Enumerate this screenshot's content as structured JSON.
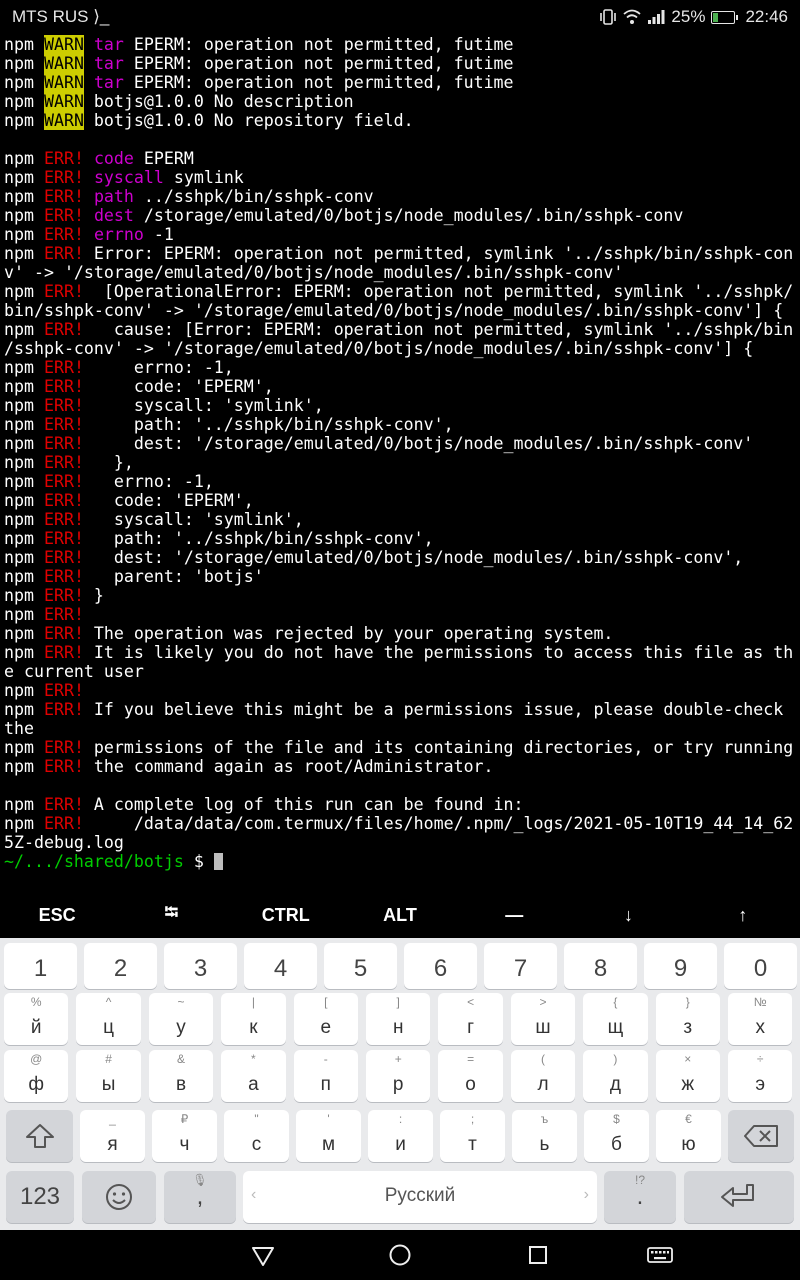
{
  "status_bar": {
    "carrier": "MTS RUS",
    "carrier_suffix": "⟩_",
    "battery": "25%",
    "battery_level": 0.25,
    "time": "22:46"
  },
  "terminal": {
    "lines": [
      [
        [
          "npm ",
          ""
        ],
        [
          "WARN",
          "warn"
        ],
        [
          " ",
          ""
        ],
        [
          "tar",
          "mag"
        ],
        [
          " EPERM: operation not permitted, futime",
          ""
        ]
      ],
      [
        [
          "npm ",
          ""
        ],
        [
          "WARN",
          "warn"
        ],
        [
          " ",
          ""
        ],
        [
          "tar",
          "mag"
        ],
        [
          " EPERM: operation not permitted, futime",
          ""
        ]
      ],
      [
        [
          "npm ",
          ""
        ],
        [
          "WARN",
          "warn"
        ],
        [
          " ",
          ""
        ],
        [
          "tar",
          "mag"
        ],
        [
          " EPERM: operation not permitted, futime",
          ""
        ]
      ],
      [
        [
          "npm ",
          ""
        ],
        [
          "WARN",
          "warn"
        ],
        [
          " botjs@1.0.0 No description",
          ""
        ]
      ],
      [
        [
          "npm ",
          ""
        ],
        [
          "WARN",
          "warn"
        ],
        [
          " botjs@1.0.0 No repository field.",
          ""
        ]
      ],
      [],
      [
        [
          "npm ",
          ""
        ],
        [
          "ERR!",
          "err"
        ],
        [
          " ",
          ""
        ],
        [
          "code",
          "mag"
        ],
        [
          " EPERM",
          ""
        ]
      ],
      [
        [
          "npm ",
          ""
        ],
        [
          "ERR!",
          "err"
        ],
        [
          " ",
          ""
        ],
        [
          "syscall",
          "mag"
        ],
        [
          " symlink",
          ""
        ]
      ],
      [
        [
          "npm ",
          ""
        ],
        [
          "ERR!",
          "err"
        ],
        [
          " ",
          ""
        ],
        [
          "path",
          "mag"
        ],
        [
          " ../sshpk/bin/sshpk-conv",
          ""
        ]
      ],
      [
        [
          "npm ",
          ""
        ],
        [
          "ERR!",
          "err"
        ],
        [
          " ",
          ""
        ],
        [
          "dest",
          "mag"
        ],
        [
          " /storage/emulated/0/botjs/node_modules/.bin/sshpk-conv",
          ""
        ]
      ],
      [
        [
          "npm ",
          ""
        ],
        [
          "ERR!",
          "err"
        ],
        [
          " ",
          ""
        ],
        [
          "errno",
          "mag"
        ],
        [
          " -1",
          ""
        ]
      ],
      [
        [
          "npm ",
          ""
        ],
        [
          "ERR!",
          "err"
        ],
        [
          " Error: EPERM: operation not permitted, symlink '../sshpk/bin/sshpk-con",
          ""
        ]
      ],
      [
        [
          "v' -> '/storage/emulated/0/botjs/node_modules/.bin/sshpk-conv'",
          ""
        ]
      ],
      [
        [
          "npm ",
          ""
        ],
        [
          "ERR!",
          "err"
        ],
        [
          "  [OperationalError: EPERM: operation not permitted, symlink '../sshpk/",
          ""
        ]
      ],
      [
        [
          "bin/sshpk-conv' -> '/storage/emulated/0/botjs/node_modules/.bin/sshpk-conv'] {",
          ""
        ]
      ],
      [
        [
          "npm ",
          ""
        ],
        [
          "ERR!",
          "err"
        ],
        [
          "   cause: [Error: EPERM: operation not permitted, symlink '../sshpk/bin",
          ""
        ]
      ],
      [
        [
          "/sshpk-conv' -> '/storage/emulated/0/botjs/node_modules/.bin/sshpk-conv'] {",
          ""
        ]
      ],
      [
        [
          "npm ",
          ""
        ],
        [
          "ERR!",
          "err"
        ],
        [
          "     errno: -1,",
          ""
        ]
      ],
      [
        [
          "npm ",
          ""
        ],
        [
          "ERR!",
          "err"
        ],
        [
          "     code: 'EPERM',",
          ""
        ]
      ],
      [
        [
          "npm ",
          ""
        ],
        [
          "ERR!",
          "err"
        ],
        [
          "     syscall: 'symlink',",
          ""
        ]
      ],
      [
        [
          "npm ",
          ""
        ],
        [
          "ERR!",
          "err"
        ],
        [
          "     path: '../sshpk/bin/sshpk-conv',",
          ""
        ]
      ],
      [
        [
          "npm ",
          ""
        ],
        [
          "ERR!",
          "err"
        ],
        [
          "     dest: '/storage/emulated/0/botjs/node_modules/.bin/sshpk-conv'",
          ""
        ]
      ],
      [
        [
          "npm ",
          ""
        ],
        [
          "ERR!",
          "err"
        ],
        [
          "   },",
          ""
        ]
      ],
      [
        [
          "npm ",
          ""
        ],
        [
          "ERR!",
          "err"
        ],
        [
          "   errno: -1,",
          ""
        ]
      ],
      [
        [
          "npm ",
          ""
        ],
        [
          "ERR!",
          "err"
        ],
        [
          "   code: 'EPERM',",
          ""
        ]
      ],
      [
        [
          "npm ",
          ""
        ],
        [
          "ERR!",
          "err"
        ],
        [
          "   syscall: 'symlink',",
          ""
        ]
      ],
      [
        [
          "npm ",
          ""
        ],
        [
          "ERR!",
          "err"
        ],
        [
          "   path: '../sshpk/bin/sshpk-conv',",
          ""
        ]
      ],
      [
        [
          "npm ",
          ""
        ],
        [
          "ERR!",
          "err"
        ],
        [
          "   dest: '/storage/emulated/0/botjs/node_modules/.bin/sshpk-conv',",
          ""
        ]
      ],
      [
        [
          "npm ",
          ""
        ],
        [
          "ERR!",
          "err"
        ],
        [
          "   parent: 'botjs'",
          ""
        ]
      ],
      [
        [
          "npm ",
          ""
        ],
        [
          "ERR!",
          "err"
        ],
        [
          " }",
          ""
        ]
      ],
      [
        [
          "npm ",
          ""
        ],
        [
          "ERR!",
          "err"
        ]
      ],
      [
        [
          "npm ",
          ""
        ],
        [
          "ERR!",
          "err"
        ],
        [
          " The operation was rejected by your operating system.",
          ""
        ]
      ],
      [
        [
          "npm ",
          ""
        ],
        [
          "ERR!",
          "err"
        ],
        [
          " It is likely you do not have the permissions to access this file as th",
          ""
        ]
      ],
      [
        [
          "e current user",
          ""
        ]
      ],
      [
        [
          "npm ",
          ""
        ],
        [
          "ERR!",
          "err"
        ]
      ],
      [
        [
          "npm ",
          ""
        ],
        [
          "ERR!",
          "err"
        ],
        [
          " If you believe this might be a permissions issue, please double-check",
          ""
        ]
      ],
      [
        [
          "the",
          ""
        ]
      ],
      [
        [
          "npm ",
          ""
        ],
        [
          "ERR!",
          "err"
        ],
        [
          " permissions of the file and its containing directories, or try running",
          ""
        ]
      ],
      [
        [
          "npm ",
          ""
        ],
        [
          "ERR!",
          "err"
        ],
        [
          " the command again as root/Administrator.",
          ""
        ]
      ],
      [],
      [
        [
          "npm ",
          ""
        ],
        [
          "ERR!",
          "err"
        ],
        [
          " A complete log of this run can be found in:",
          ""
        ]
      ],
      [
        [
          "npm ",
          ""
        ],
        [
          "ERR!",
          "err"
        ],
        [
          "     /data/data/com.termux/files/home/.npm/_logs/2021-05-10T19_44_14_62",
          ""
        ]
      ],
      [
        [
          "5Z-debug.log",
          ""
        ]
      ]
    ],
    "prompt_path": "~/.../shared/botjs",
    "prompt_symbol": " $ "
  },
  "extra_keys": [
    "ESC",
    "⭾",
    "CTRL",
    "ALT",
    "—",
    "↓",
    "↑"
  ],
  "keyboard": {
    "numbers": [
      "1",
      "2",
      "3",
      "4",
      "5",
      "6",
      "7",
      "8",
      "9",
      "0"
    ],
    "row1": [
      [
        "%",
        "й"
      ],
      [
        "^",
        "ц"
      ],
      [
        "~",
        "у"
      ],
      [
        "|",
        "к"
      ],
      [
        "[",
        "е"
      ],
      [
        "]",
        "н"
      ],
      [
        "<",
        "г"
      ],
      [
        ">",
        "ш"
      ],
      [
        "{",
        "щ"
      ],
      [
        "}",
        "з"
      ],
      [
        "№",
        "х"
      ]
    ],
    "row2": [
      [
        "@",
        "ф"
      ],
      [
        "#",
        "ы"
      ],
      [
        "&",
        "в"
      ],
      [
        "*",
        "а"
      ],
      [
        "-",
        "п"
      ],
      [
        "+",
        "р"
      ],
      [
        "=",
        "о"
      ],
      [
        "(",
        "л"
      ],
      [
        ")",
        "д"
      ],
      [
        "×",
        "ж"
      ],
      [
        "÷",
        "э"
      ]
    ],
    "row3": [
      [
        "_",
        "я"
      ],
      [
        "₽",
        "ч"
      ],
      [
        "\"",
        "с"
      ],
      [
        "'",
        "м"
      ],
      [
        ":",
        "и"
      ],
      [
        ";",
        "т"
      ],
      [
        "ъ",
        "ь"
      ],
      [
        "$",
        "б"
      ],
      [
        "€",
        "ю"
      ]
    ],
    "mode_label": "123",
    "comma_hint": "🎙",
    "comma_label": ",",
    "space_label": "Русский",
    "period_hint": "!?",
    "period_label": "."
  }
}
